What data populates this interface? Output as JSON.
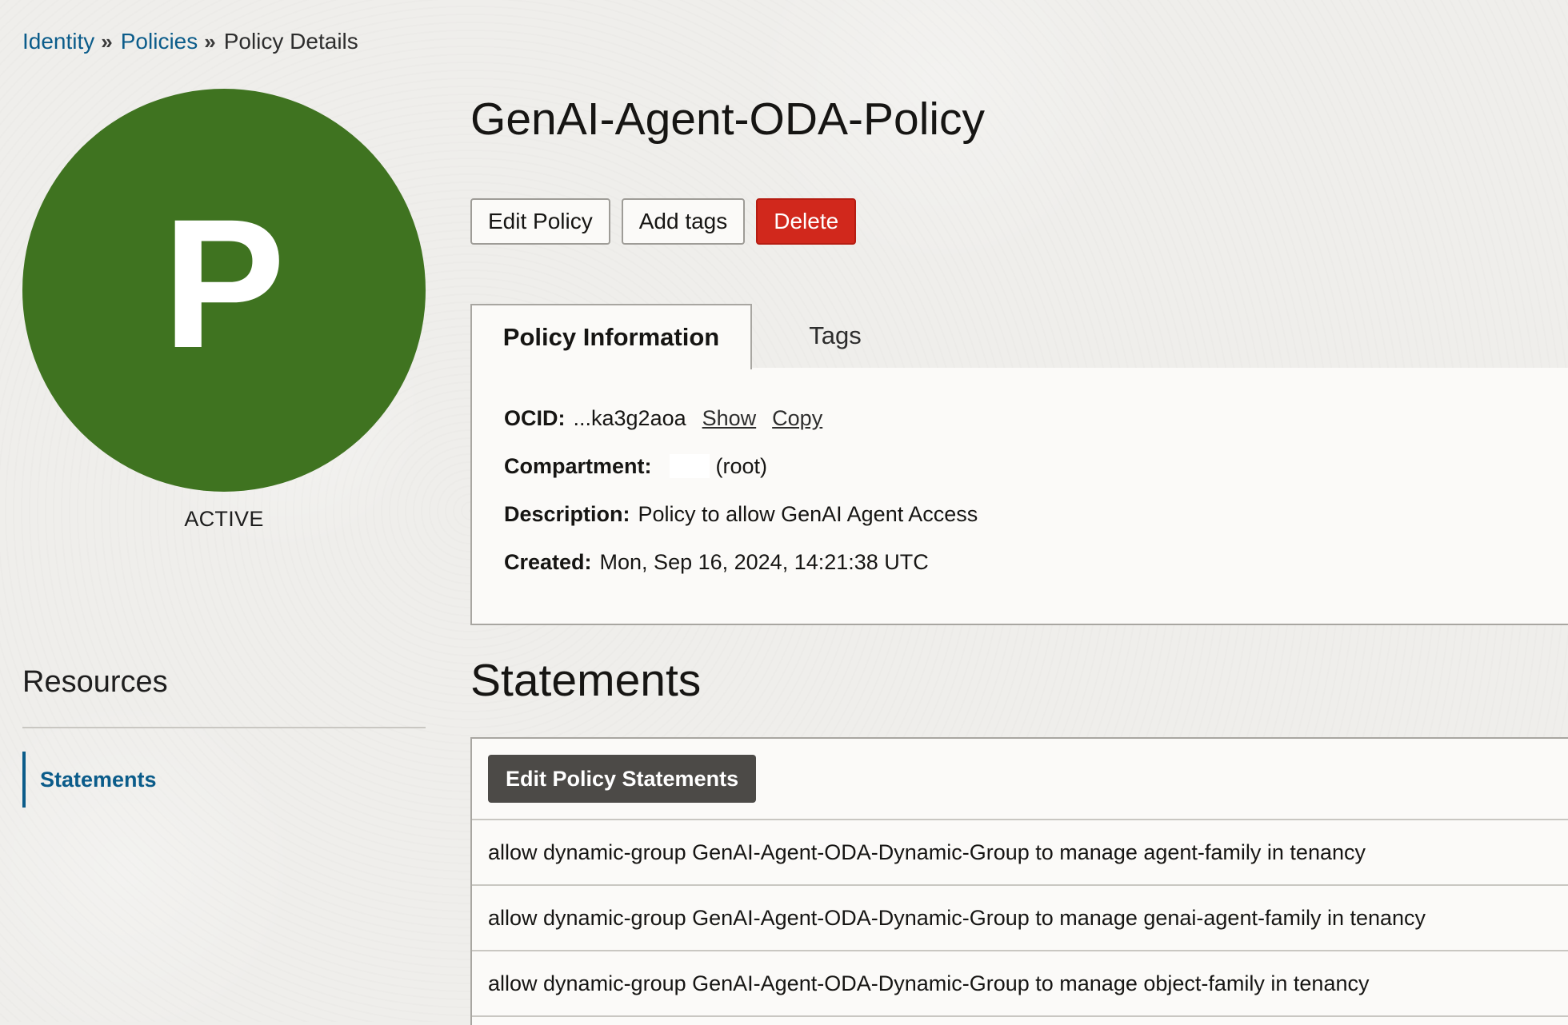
{
  "breadcrumb": {
    "items": [
      "Identity",
      "Policies"
    ],
    "separator": "»",
    "current": "Policy Details"
  },
  "avatar": {
    "letter": "P",
    "color": "#3f7320",
    "status": "ACTIVE"
  },
  "resources": {
    "heading": "Resources",
    "items": [
      {
        "label": "Statements",
        "active": true
      }
    ]
  },
  "title": "GenAI-Agent-ODA-Policy",
  "actions": {
    "edit_label": "Edit Policy",
    "tags_label": "Add tags",
    "delete_label": "Delete"
  },
  "tabs": [
    {
      "label": "Policy Information",
      "active": true
    },
    {
      "label": "Tags",
      "active": false
    }
  ],
  "info": {
    "ocid_label": "OCID:",
    "ocid_value": "...ka3g2aoa",
    "show_label": "Show",
    "copy_label": "Copy",
    "compartment_label": "Compartment:",
    "compartment_value": "(root)",
    "description_label": "Description:",
    "description_value": "Policy to allow GenAI Agent Access",
    "created_label": "Created:",
    "created_value": "Mon, Sep 16, 2024, 14:21:38 UTC"
  },
  "statements": {
    "heading": "Statements",
    "edit_button_label": "Edit Policy Statements",
    "rows": [
      "allow dynamic-group GenAI-Agent-ODA-Dynamic-Group to manage agent-family in tenancy",
      "allow dynamic-group GenAI-Agent-ODA-Dynamic-Group to manage genai-agent-family in tenancy",
      "allow dynamic-group GenAI-Agent-ODA-Dynamic-Group to manage object-family in tenancy"
    ]
  },
  "colors": {
    "link": "#0b5c8a",
    "danger": "#d1281c",
    "avatar": "#3f7320",
    "dark_button": "#4c4a47"
  }
}
